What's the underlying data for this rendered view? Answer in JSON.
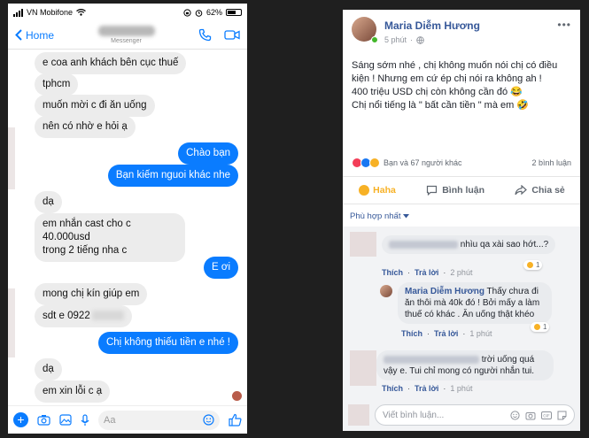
{
  "status_bar": {
    "carrier": "VN Mobifone",
    "battery": "62%"
  },
  "messenger": {
    "back_label": "Home",
    "subtitle": "Messenger",
    "messages": [
      {
        "side": "in",
        "text": "e coa anh khách bên cục thuế"
      },
      {
        "side": "in",
        "text": "tphcm"
      },
      {
        "side": "in",
        "text": "muốn mời c đi ăn uống"
      },
      {
        "side": "in",
        "text": "nên có nhờ e hỏi ạ"
      },
      {
        "side": "out",
        "text": "Chào bạn"
      },
      {
        "side": "out",
        "text": "Bạn kiếm nguoi khác nhe"
      },
      {
        "side": "in",
        "text": "dạ"
      },
      {
        "side": "in",
        "text": "em nhắn cast cho c 40.000usd"
      },
      {
        "side": "in",
        "text": "trong 2 tiếng nha c"
      },
      {
        "side": "out",
        "text": "E ơi"
      },
      {
        "side": "in",
        "text": "mong chị kín giúp em"
      },
      {
        "side": "in",
        "text": "sdt e 0922"
      },
      {
        "side": "out",
        "text": "Chị không thiếu tiền e nhé !"
      },
      {
        "side": "in",
        "text": "dạ"
      },
      {
        "side": "in",
        "text": "em xin lỗi c ạ"
      }
    ],
    "composer_placeholder": "Aa"
  },
  "post": {
    "author": "Maria Diễm Hương",
    "time": "5 phút",
    "lines": [
      "Sáng sớm nhé , chị không muốn nói chị có điều",
      "kiện ! Nhưng em cứ ép chị nói ra không ah !",
      "400 triệu USD chị còn không cần đó 😂",
      "Chị nổi tiếng là \" bất cần tiền \" mà em 🤣"
    ],
    "reactions_text": "Bạn và 67 người khác",
    "comment_count": "2 bình luận",
    "actions": {
      "haha": "Haha",
      "comment": "Bình luận",
      "share": "Chia sẻ"
    },
    "filter_label": "Phù hợp nhất",
    "comments": [
      {
        "name": "",
        "text": "nhìu qa xài sao hớt...?",
        "like": "Thích",
        "reply": "Trả lời",
        "time": "2 phút",
        "react_count": "1"
      },
      {
        "name": "Maria Diễm Hương",
        "text": "Thấy chưa đi ăn thôi mà 40k đó ! Bởi mấy a làm thuế có khác . Ăn uống thật khéo",
        "like": "Thích",
        "reply": "Trả lời",
        "time": "1 phút",
        "react_count": "1"
      },
      {
        "name": "",
        "text": "trời uống quá vậy e. Tui chỉ mong có người nhắn tui.",
        "like": "Thích",
        "reply": "Trả lời",
        "time": "1 phút"
      }
    ],
    "reply_placeholder": "Viết bình luận..."
  },
  "colors": {
    "messenger_blue": "#0a7cff",
    "fb_link": "#365899",
    "haha_yellow": "#f7b125"
  }
}
